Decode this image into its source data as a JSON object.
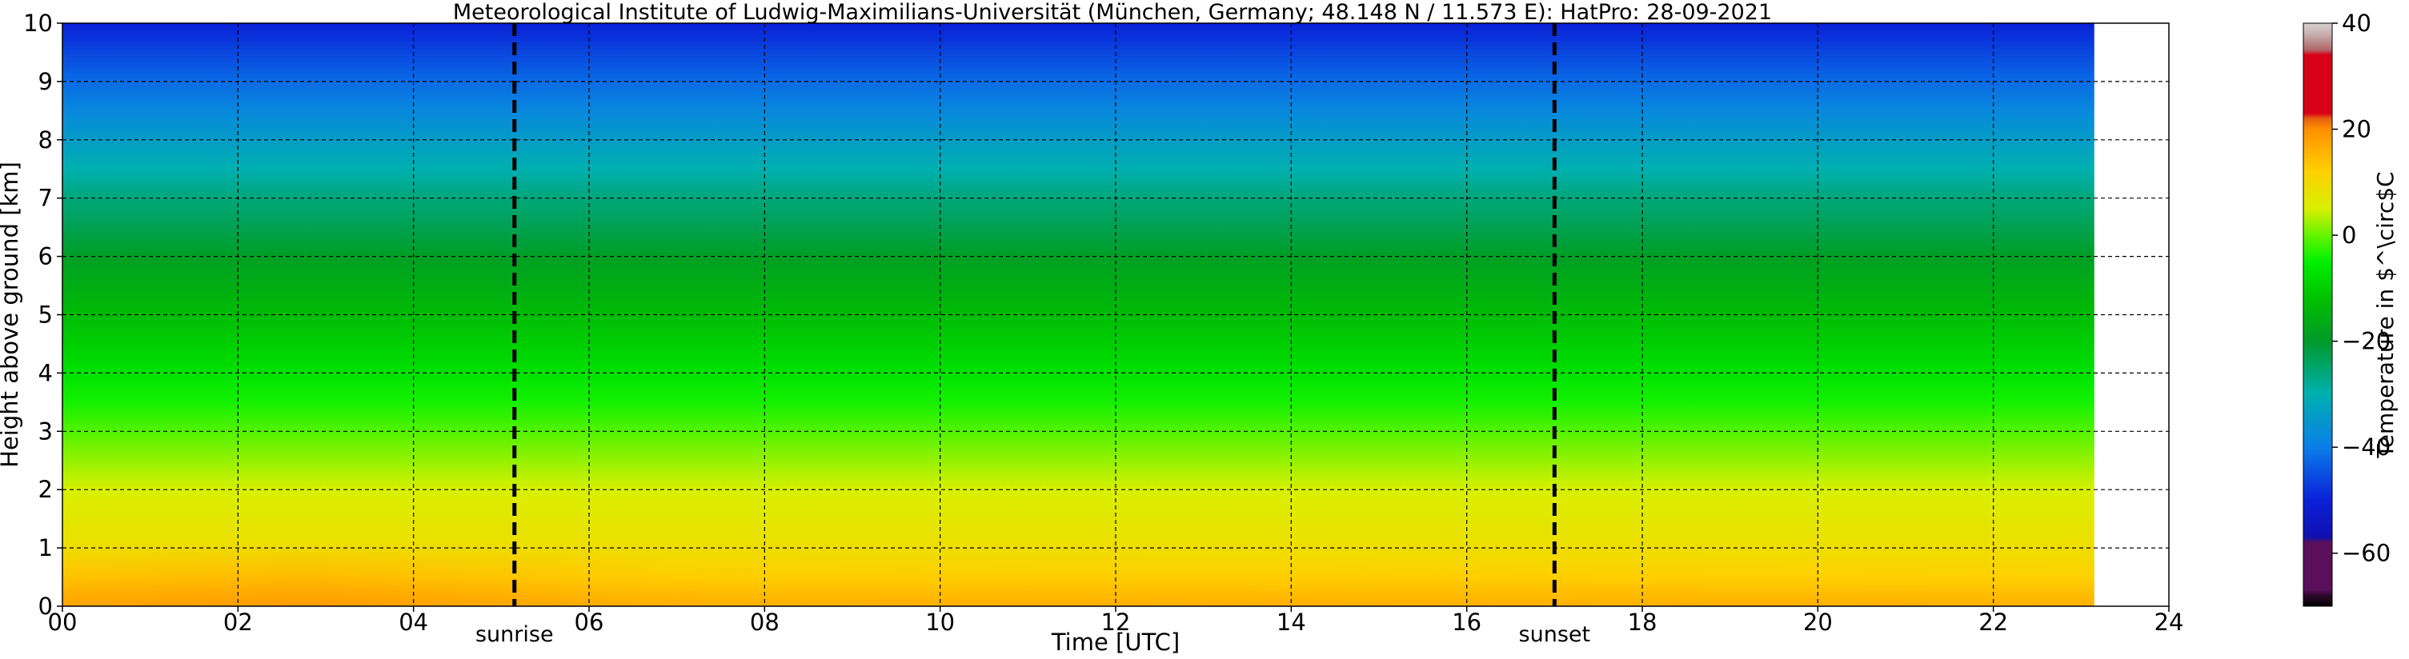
{
  "chart_data": {
    "type": "heatmap",
    "title": "Meteorological Institute of Ludwig-Maximilians-Universität (München, Germany; 48.148 N / 11.573 E):    HatPro: 28-09-2021",
    "xlabel": "Time [UTC]",
    "ylabel": "Height above ground [km]",
    "colorbar_label": "Temperature in $^\\circ$C",
    "xlim": [
      0,
      24
    ],
    "ylim": [
      0,
      10
    ],
    "x_ticks": [
      0,
      2,
      4,
      6,
      8,
      10,
      12,
      14,
      16,
      18,
      20,
      22,
      24
    ],
    "x_tick_labels": [
      "00",
      "02",
      "04",
      "06",
      "08",
      "10",
      "12",
      "14",
      "16",
      "18",
      "20",
      "22",
      "24"
    ],
    "y_ticks": [
      0,
      1,
      2,
      3,
      4,
      5,
      6,
      7,
      8,
      9,
      10
    ],
    "y_tick_labels": [
      "0",
      "1",
      "2",
      "3",
      "4",
      "5",
      "6",
      "7",
      "8",
      "9",
      "10"
    ],
    "grid": true,
    "data_time_range": [
      0,
      23.15
    ],
    "colorbar": {
      "range": [
        -70,
        40
      ],
      "ticks": [
        40,
        20,
        0,
        -20,
        -40,
        -60
      ],
      "tick_labels": [
        "40",
        "20",
        "0",
        "−20",
        "−40",
        "−60"
      ]
    },
    "temperature_profile": {
      "height_km": [
        0,
        0.5,
        1,
        1.5,
        2,
        2.5,
        3,
        3.5,
        4,
        5,
        6,
        6.5,
        7,
        7.5,
        8,
        8.5,
        9,
        9.5,
        10
      ],
      "temp_c": [
        16,
        12,
        9,
        7,
        5,
        2,
        -1,
        -4,
        -7,
        -13,
        -19,
        -23,
        -26,
        -30,
        -34,
        -38,
        -42,
        -46,
        -50
      ]
    },
    "annotations": [
      {
        "label": "sunrise",
        "x": 5.15
      },
      {
        "label": "sunset",
        "x": 17.0
      }
    ],
    "colors": {
      "grid": "#000000",
      "sun_lines": "#000000",
      "colormap_stops": [
        {
          "v": -70,
          "c": "#000000"
        },
        {
          "v": -68,
          "c": "#2a0a2a"
        },
        {
          "v": -67,
          "c": "#5a0f5a"
        },
        {
          "v": -58,
          "c": "#5a0f5a"
        },
        {
          "v": -57,
          "c": "#1010b0"
        },
        {
          "v": -50,
          "c": "#0a20d8"
        },
        {
          "v": -40,
          "c": "#0a7ee8"
        },
        {
          "v": -30,
          "c": "#00b0b0"
        },
        {
          "v": -20,
          "c": "#009a2a"
        },
        {
          "v": -12,
          "c": "#00c000"
        },
        {
          "v": -5,
          "c": "#00f000"
        },
        {
          "v": 0,
          "c": "#66f400"
        },
        {
          "v": 5,
          "c": "#d8f000"
        },
        {
          "v": 12,
          "c": "#ffd000"
        },
        {
          "v": 20,
          "c": "#ff9000"
        },
        {
          "v": 22,
          "c": "#e86010"
        },
        {
          "v": 23,
          "c": "#d80018"
        },
        {
          "v": 34,
          "c": "#d80018"
        },
        {
          "v": 35,
          "c": "#b06868"
        },
        {
          "v": 38,
          "c": "#c8b0b0"
        },
        {
          "v": 40,
          "c": "#d8d0d0"
        }
      ]
    }
  }
}
